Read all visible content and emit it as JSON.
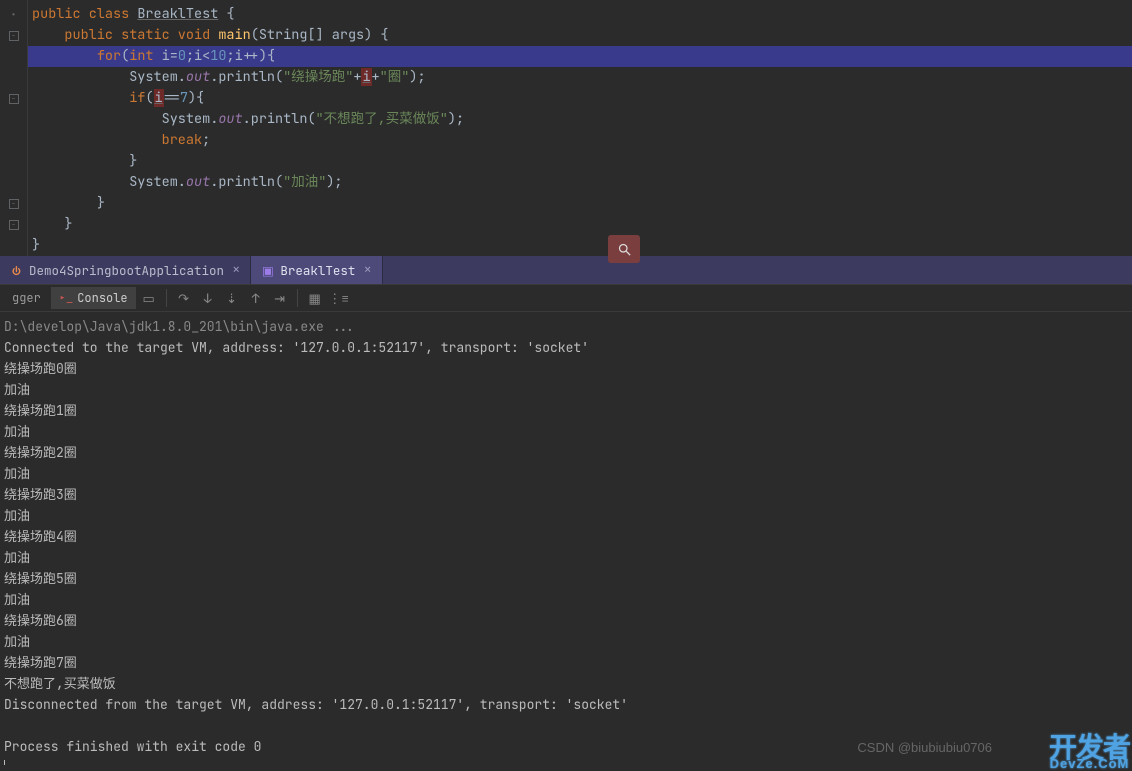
{
  "code": {
    "class_kw": "public class",
    "class_name": "BreaklTest",
    "open_brace": " {",
    "main_sig_pre": "public static void ",
    "main_name": "main",
    "main_params_open": "(",
    "main_params_type": "String",
    "main_params_arr": "[] ",
    "main_params_name": "args",
    "main_params_close": ")",
    "main_brace": " {",
    "for_kw": "for",
    "for_cond_open": "(",
    "for_int": "int ",
    "for_init": "i=",
    "for_zero": "0",
    "for_sep1": ";i<",
    "for_ten": "10",
    "for_sep2": ";i++",
    "for_cond_close": ")",
    "for_brace": "{",
    "println1_pre": "System.",
    "println1_out": "out",
    "println1_dot": ".println(",
    "println1_str": "\"绕操场跑\"",
    "println1_plus": "+",
    "println1_i": "i",
    "println1_plus2": "+",
    "println1_str2": "\"圈\"",
    "println1_end": ");",
    "if_kw": "if",
    "if_open": "(",
    "if_expr_i": "i",
    "if_expr_eq": "==",
    "if_expr_7": "7",
    "if_close": ")",
    "if_brace": "{",
    "println2_pre": "System.",
    "println2_out": "out",
    "println2_dot": ".println(",
    "println2_str": "\"不想跑了,买菜做饭\"",
    "println2_end": ");",
    "break_kw": "break",
    "break_end": ";",
    "close_if": "}",
    "println3_pre": "System.",
    "println3_out": "out",
    "println3_dot": ".println(",
    "println3_str": "\"加油\"",
    "println3_end": ");",
    "close_for": "}",
    "close_main": "}",
    "close_class": "}"
  },
  "tabs": [
    {
      "label": "Demo4SpringbootApplication",
      "icon": "run-config"
    },
    {
      "label": "BreaklTest",
      "icon": "run-config"
    }
  ],
  "toolbar": {
    "debugger_label": "gger",
    "console_label": "Console"
  },
  "console": {
    "lines": [
      "D:\\develop\\Java\\jdk1.8.0_201\\bin\\java.exe ...",
      "Connected to the target VM, address: '127.0.0.1:52117', transport: 'socket'",
      "绕操场跑0圈",
      "加油",
      "绕操场跑1圈",
      "加油",
      "绕操场跑2圈",
      "加油",
      "绕操场跑3圈",
      "加油",
      "绕操场跑4圈",
      "加油",
      "绕操场跑5圈",
      "加油",
      "绕操场跑6圈",
      "加油",
      "绕操场跑7圈",
      "不想跑了,买菜做饭",
      "Disconnected from the target VM, address: '127.0.0.1:52117', transport: 'socket'",
      "",
      "Process finished with exit code 0"
    ]
  },
  "watermark": {
    "csdn": "CSDN @biubiubiu0706",
    "brand_top": "开发者",
    "brand_sub": "DevZe.CoM"
  }
}
